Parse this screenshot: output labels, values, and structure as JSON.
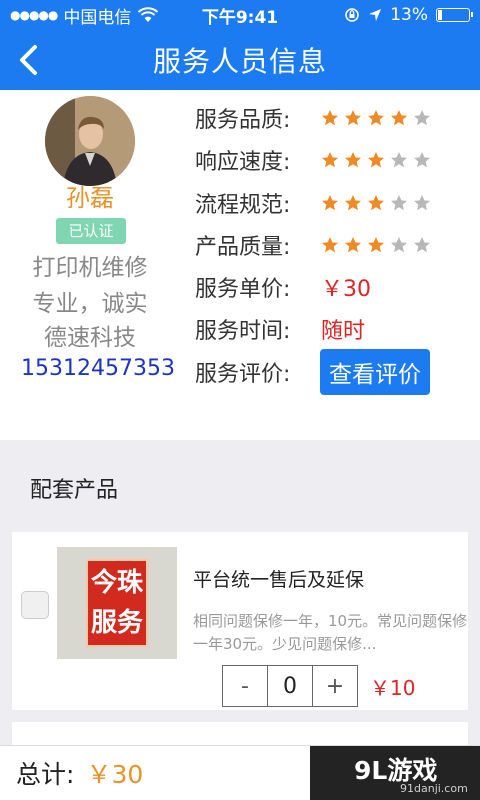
{
  "status_bar": {
    "carrier": "中国电信",
    "time": "下午9:41",
    "battery": "13%",
    "battery_level": 0.13
  },
  "header": {
    "title": "服务人员信息"
  },
  "profile": {
    "name": "孙磊",
    "verified": "已认证",
    "description_lines": [
      "打印机维修",
      "专业，诚实",
      "德速科技"
    ],
    "phone": "15312457353"
  },
  "details": {
    "service_quality": {
      "label": "服务品质:",
      "stars": 4
    },
    "response_speed": {
      "label": "响应速度:",
      "stars": 3
    },
    "process_standard": {
      "label": "流程规范:",
      "stars": 3
    },
    "product_quality": {
      "label": "产品质量:",
      "stars": 3
    },
    "unit_price": {
      "label": "服务单价:",
      "value": "￥30"
    },
    "service_time": {
      "label": "服务时间:",
      "value": "随时"
    },
    "review": {
      "label": "服务评价:",
      "button": "查看评价"
    }
  },
  "star_max": 5,
  "section": {
    "title": "配套产品"
  },
  "product": {
    "image_text": [
      "今珠",
      "服务"
    ],
    "name": "平台统一售后及延保",
    "description": "相同问题保修一年，10元。常见问题保修一年30元。少见问题保修...",
    "quantity": "0",
    "minus": "-",
    "plus": "+",
    "price": "￥10"
  },
  "footer": {
    "total_label": "总计:",
    "total_value": "￥30"
  },
  "watermark": {
    "main": "9L游戏",
    "sub": "91danji.com"
  },
  "colors": {
    "brand_blue": "#1d7bf1",
    "star_on": "#f08a24",
    "star_off": "#b8b8b8",
    "price_red": "#e02424",
    "name_orange": "#e8922a"
  },
  "icons": {
    "back": "chevron-left-icon",
    "wifi": "wifi-icon",
    "location": "location-arrow-icon",
    "lock": "orientation-lock-icon"
  }
}
